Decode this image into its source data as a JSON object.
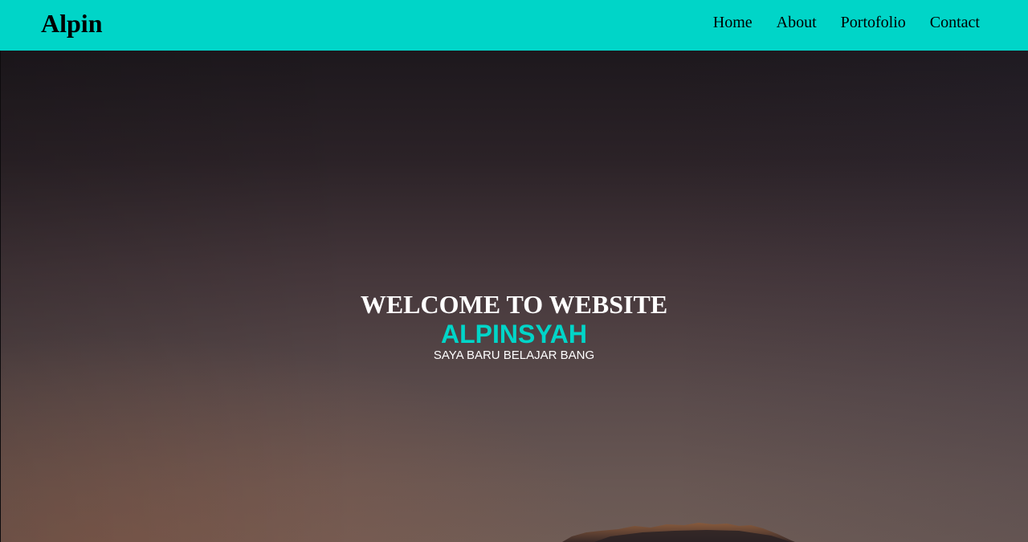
{
  "navbar": {
    "brand": "Alpin",
    "background_color": "#00d5c8",
    "links": [
      {
        "label": "Home"
      },
      {
        "label": "About"
      },
      {
        "label": "Portofolio"
      },
      {
        "label": "Contact"
      }
    ]
  },
  "hero": {
    "heading": "WELCOME TO WEBSITE",
    "name": "ALPINSYAH",
    "tagline": "SAYA BARU BELAJAR BANG",
    "accent_color": "#00d5c8",
    "background_image": "dusk sky with mountain silhouette"
  }
}
